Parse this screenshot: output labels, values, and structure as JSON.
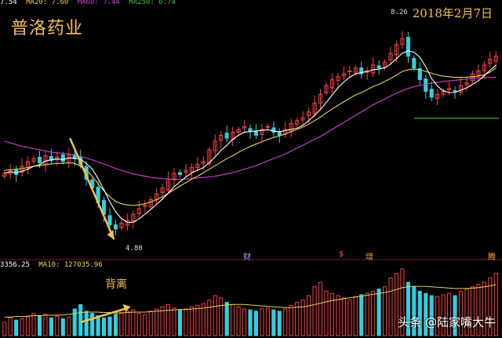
{
  "header": {
    "ma_legend": [
      {
        "text": "7.54",
        "color": "#ffffff"
      },
      {
        "text": "MA20: 7.60",
        "color": "#e8d44d"
      },
      {
        "text": "MA60: 7.44",
        "color": "#d040d0"
      },
      {
        "text": "MA250: 6.74",
        "color": "#40c040"
      }
    ],
    "stock_name": "普洛药业",
    "date": "2018年2月7日"
  },
  "annotations": {
    "peak": "8.26",
    "low": "4.80",
    "divergence": "背离",
    "markers": [
      {
        "text": "财",
        "color": "#8fb0ff"
      },
      {
        "text": "$",
        "color": "#ff5050"
      },
      {
        "text": "增",
        "color": "#ffa040"
      },
      {
        "text": "腾",
        "color": "#ffa040"
      }
    ]
  },
  "volume_legend": [
    {
      "text": "3356.25",
      "color": "#ffffff"
    },
    {
      "text": "MA10: 127035.96",
      "color": "#e8d44d"
    }
  ],
  "watermark": "头条 @陆家嘴大牛",
  "colors": {
    "up": "#ff4040",
    "down": "#30d0e0",
    "ma_short": "#ffffff",
    "ma_mid": "#e8d44d",
    "ma_long": "#d040d0",
    "ma_250": "#40c040",
    "arrow": "#f4c14d"
  },
  "chart_data": {
    "type": "candlestick",
    "ylim": [
      4.5,
      8.6
    ],
    "closes": [
      5.8,
      5.85,
      5.78,
      5.92,
      6.0,
      6.05,
      5.98,
      6.1,
      6.02,
      6.08,
      6.0,
      6.12,
      6.05,
      5.95,
      5.7,
      5.55,
      5.3,
      5.1,
      4.92,
      4.85,
      4.95,
      5.0,
      5.1,
      5.2,
      5.25,
      5.35,
      5.45,
      5.55,
      5.7,
      5.8,
      5.78,
      5.85,
      5.9,
      5.95,
      6.0,
      6.2,
      6.35,
      6.45,
      6.4,
      6.5,
      6.55,
      6.6,
      6.52,
      6.45,
      6.55,
      6.6,
      6.5,
      6.45,
      6.55,
      6.65,
      6.7,
      6.75,
      6.85,
      7.0,
      7.15,
      7.3,
      7.4,
      7.45,
      7.5,
      7.55,
      7.6,
      7.5,
      7.55,
      7.65,
      7.6,
      7.7,
      7.85,
      8.0,
      8.1,
      7.8,
      7.6,
      7.4,
      7.2,
      7.1,
      7.15,
      7.2,
      7.25,
      7.2,
      7.3,
      7.35,
      7.5,
      7.55,
      7.65,
      7.75,
      7.8
    ],
    "ma20": [
      5.85,
      5.86,
      5.87,
      5.88,
      5.9,
      5.92,
      5.93,
      5.95,
      5.96,
      5.97,
      5.97,
      5.98,
      5.97,
      5.92,
      5.85,
      5.75,
      5.62,
      5.5,
      5.4,
      5.32,
      5.28,
      5.26,
      5.25,
      5.26,
      5.28,
      5.31,
      5.35,
      5.4,
      5.46,
      5.52,
      5.58,
      5.64,
      5.7,
      5.75,
      5.81,
      5.87,
      5.93,
      5.99,
      6.05,
      6.1,
      6.16,
      6.21,
      6.26,
      6.3,
      6.34,
      6.38,
      6.41,
      6.44,
      6.47,
      6.51,
      6.55,
      6.59,
      6.64,
      6.7,
      6.76,
      6.83,
      6.9,
      6.96,
      7.02,
      7.08,
      7.14,
      7.18,
      7.23,
      7.28,
      7.32,
      7.37,
      7.42,
      7.48,
      7.54,
      7.57,
      7.58,
      7.57,
      7.54,
      7.51,
      7.48,
      7.46,
      7.45,
      7.44,
      7.44,
      7.44,
      7.45,
      7.46,
      7.48,
      7.53,
      7.6
    ],
    "ma60": [
      6.35,
      6.32,
      6.29,
      6.26,
      6.24,
      6.22,
      6.2,
      6.18,
      6.16,
      6.15,
      6.14,
      6.13,
      6.11,
      6.09,
      6.06,
      6.03,
      5.99,
      5.96,
      5.92,
      5.88,
      5.85,
      5.82,
      5.79,
      5.77,
      5.75,
      5.73,
      5.72,
      5.71,
      5.7,
      5.7,
      5.7,
      5.7,
      5.71,
      5.72,
      5.73,
      5.74,
      5.75,
      5.77,
      5.79,
      5.81,
      5.84,
      5.87,
      5.9,
      5.93,
      5.97,
      6.01,
      6.05,
      6.09,
      6.13,
      6.18,
      6.23,
      6.28,
      6.33,
      6.38,
      6.43,
      6.49,
      6.55,
      6.61,
      6.67,
      6.73,
      6.79,
      6.85,
      6.91,
      6.97,
      7.02,
      7.07,
      7.12,
      7.17,
      7.21,
      7.25,
      7.28,
      7.3,
      7.32,
      7.34,
      7.35,
      7.37,
      7.38,
      7.39,
      7.4,
      7.41,
      7.42,
      7.43,
      7.43,
      7.44,
      7.44
    ],
    "ma250_start_index": 70,
    "ma250_level": 6.74,
    "volume": [
      30,
      40,
      35,
      38,
      42,
      50,
      45,
      48,
      40,
      44,
      38,
      42,
      60,
      70,
      55,
      50,
      45,
      40,
      42,
      48,
      52,
      55,
      58,
      50,
      48,
      55,
      60,
      65,
      70,
      62,
      58,
      60,
      65,
      68,
      72,
      80,
      90,
      85,
      75,
      70,
      65,
      60,
      58,
      55,
      60,
      62,
      58,
      55,
      60,
      68,
      75,
      80,
      90,
      110,
      120,
      100,
      95,
      90,
      85,
      80,
      88,
      92,
      95,
      100,
      105,
      110,
      130,
      140,
      150,
      120,
      110,
      100,
      95,
      90,
      88,
      92,
      95,
      90,
      100,
      105,
      110,
      115,
      120,
      130,
      140
    ],
    "volume_ma": [
      42,
      42,
      43,
      43,
      44,
      45,
      45,
      46,
      46,
      46,
      47,
      48,
      50,
      52,
      53,
      53,
      53,
      52,
      52,
      51,
      51,
      52,
      53,
      53,
      53,
      54,
      55,
      56,
      57,
      58,
      59,
      59,
      60,
      61,
      62,
      64,
      66,
      68,
      69,
      70,
      70,
      70,
      69,
      68,
      67,
      66,
      65,
      64,
      63,
      63,
      64,
      65,
      67,
      70,
      73,
      76,
      79,
      81,
      83,
      85,
      87,
      89,
      91,
      93,
      95,
      97,
      100,
      104,
      108,
      110,
      111,
      111,
      111,
      110,
      109,
      108,
      107,
      106,
      106,
      106,
      107,
      108,
      110,
      112,
      115
    ]
  }
}
